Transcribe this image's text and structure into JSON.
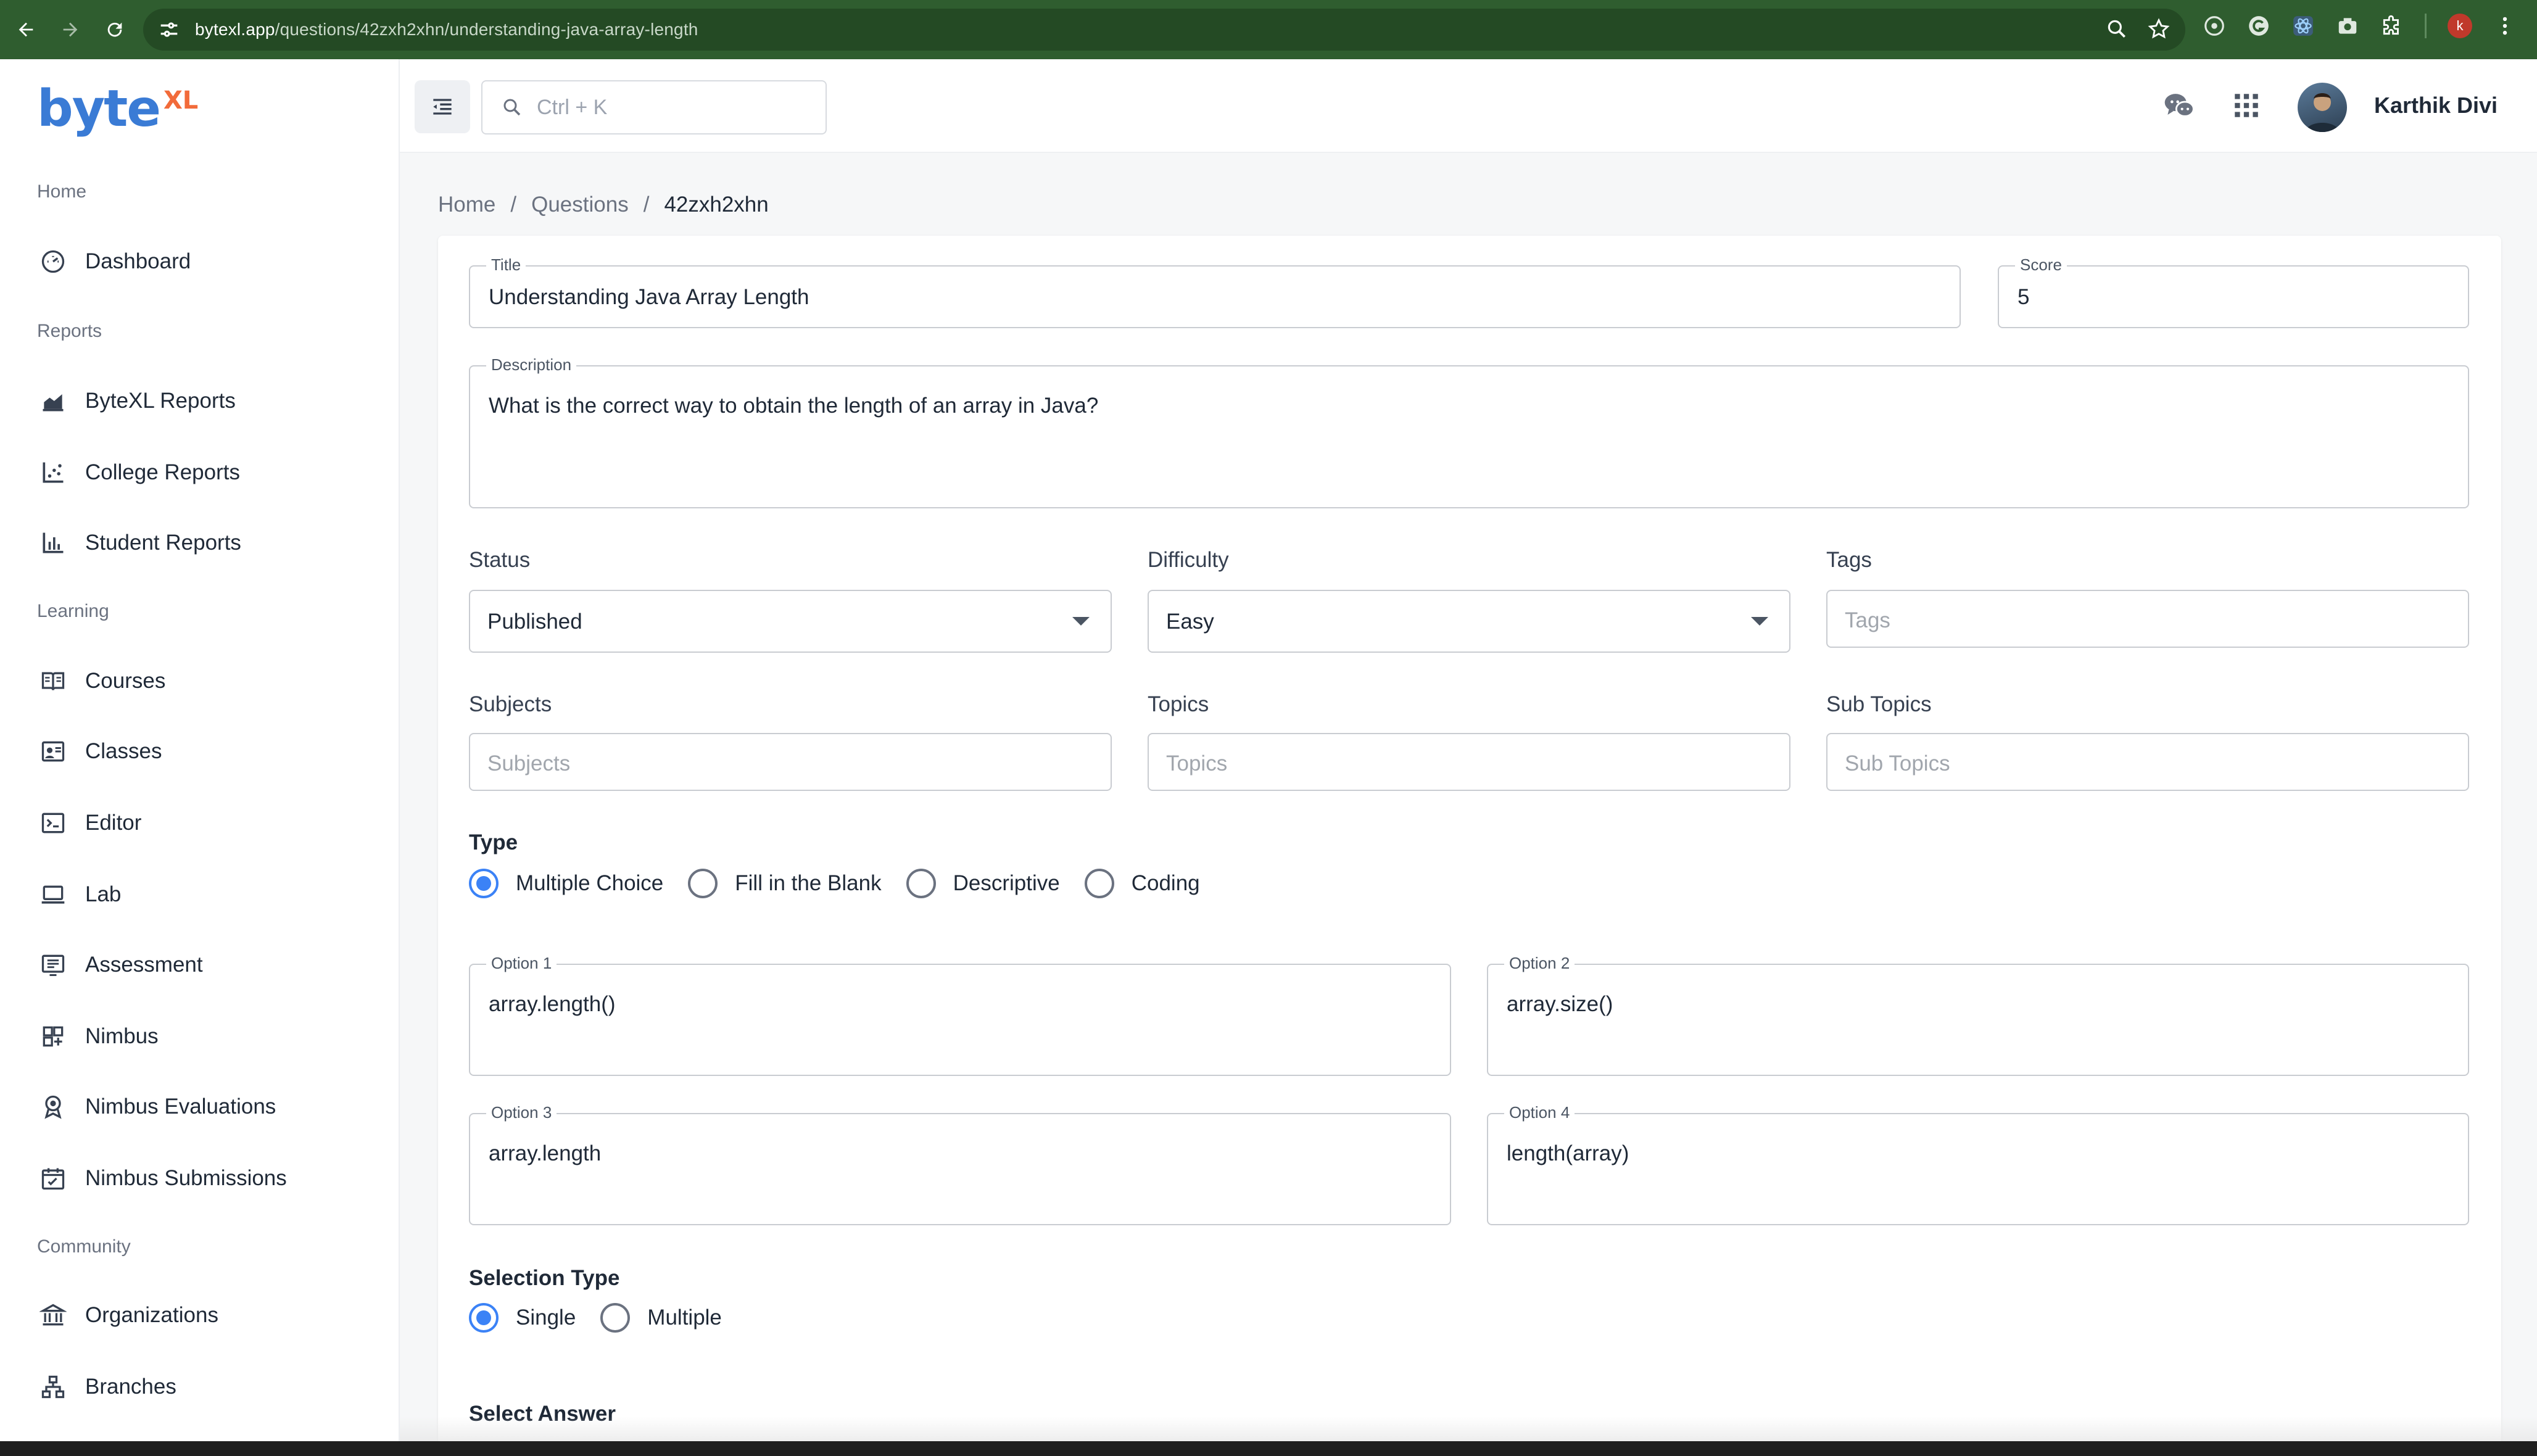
{
  "browser": {
    "url_host": "bytexl.app",
    "url_path": "/questions/42zxh2xhn/understanding-java-array-length",
    "profile_initial": "k"
  },
  "brand": {
    "logo_text": "byte",
    "logo_superscript": "XL",
    "primary_color": "#3a7bd5",
    "accent_color": "#f26b3a"
  },
  "sidebar": {
    "sections": [
      {
        "title": "Home",
        "items": [
          {
            "label": "Dashboard",
            "icon": "dashboard-icon"
          }
        ]
      },
      {
        "title": "Reports",
        "items": [
          {
            "label": "ByteXL Reports",
            "icon": "area-chart-icon"
          },
          {
            "label": "College Reports",
            "icon": "scatter-chart-icon"
          },
          {
            "label": "Student Reports",
            "icon": "bar-chart-icon"
          }
        ]
      },
      {
        "title": "Learning",
        "items": [
          {
            "label": "Courses",
            "icon": "book-icon"
          },
          {
            "label": "Classes",
            "icon": "class-icon"
          },
          {
            "label": "Editor",
            "icon": "terminal-icon"
          },
          {
            "label": "Lab",
            "icon": "laptop-icon"
          },
          {
            "label": "Assessment",
            "icon": "assessment-icon"
          },
          {
            "label": "Nimbus",
            "icon": "grid-icon"
          },
          {
            "label": "Nimbus Evaluations",
            "icon": "badge-icon"
          },
          {
            "label": "Nimbus Submissions",
            "icon": "calendar-check-icon"
          }
        ]
      },
      {
        "title": "Community",
        "items": [
          {
            "label": "Organizations",
            "icon": "institution-icon"
          },
          {
            "label": "Branches",
            "icon": "hierarchy-icon"
          }
        ]
      }
    ]
  },
  "topbar": {
    "search_placeholder": "Ctrl + K",
    "user_name": "Karthik Divi"
  },
  "breadcrumb": {
    "home": "Home",
    "questions": "Questions",
    "current": "42zxh2xhn",
    "separator": "/"
  },
  "form": {
    "title_label": "Title",
    "title_value": "Understanding Java Array Length",
    "score_label": "Score",
    "score_value": "5",
    "description_label": "Description",
    "description_value": "What is the correct way to obtain the length of an array in Java?",
    "status_label": "Status",
    "status_value": "Published",
    "difficulty_label": "Difficulty",
    "difficulty_value": "Easy",
    "tags_label": "Tags",
    "tags_placeholder": "Tags",
    "subjects_label": "Subjects",
    "subjects_placeholder": "Subjects",
    "topics_label": "Topics",
    "topics_placeholder": "Topics",
    "subtopics_label": "Sub Topics",
    "subtopics_placeholder": "Sub Topics",
    "type_label": "Type",
    "type_options": [
      "Multiple Choice",
      "Fill in the Blank",
      "Descriptive",
      "Coding"
    ],
    "type_selected": "Multiple Choice",
    "options": [
      {
        "label": "Option 1",
        "value": "array.length()"
      },
      {
        "label": "Option 2",
        "value": "array.size()"
      },
      {
        "label": "Option 3",
        "value": "array.length"
      },
      {
        "label": "Option 4",
        "value": "length(array)"
      }
    ],
    "selection_type_label": "Selection Type",
    "selection_type_options": [
      "Single",
      "Multiple"
    ],
    "selection_type_selected": "Single",
    "select_answer_label": "Select Answer"
  }
}
